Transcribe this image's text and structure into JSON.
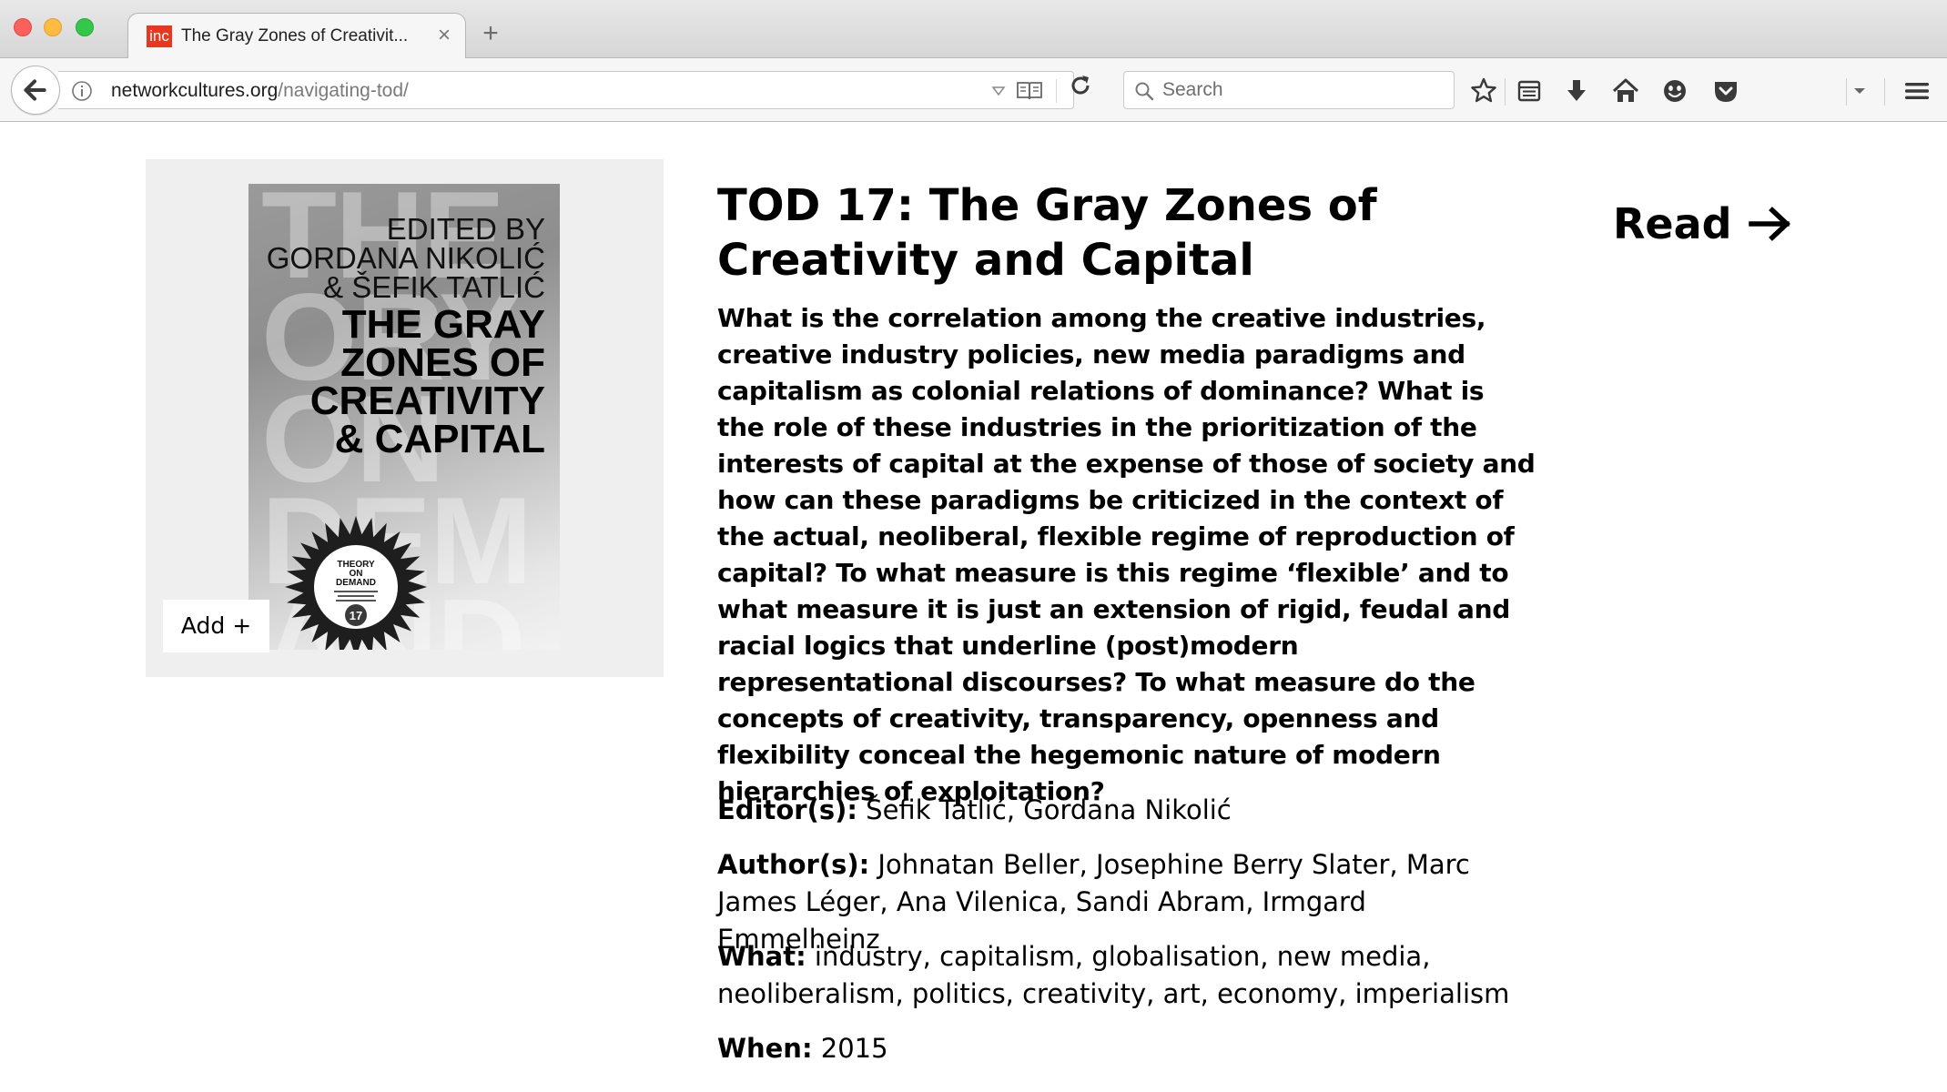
{
  "browser": {
    "tab": {
      "favicon_text": "inc",
      "title": "The Gray Zones of Creativit...",
      "close": "×"
    },
    "new_tab": "+",
    "url": {
      "domain": "networkcultures.org",
      "path": "/navigating-tod/"
    },
    "search": {
      "placeholder": "Search"
    },
    "icons": [
      "back-arrow-icon",
      "info-icon",
      "dropdown-icon",
      "reader-view-icon",
      "reload-icon",
      "search-icon",
      "bookmark-star-icon",
      "bookmarks-library-icon",
      "download-icon",
      "home-icon",
      "emoji-icon",
      "pocket-icon",
      "overflow-dropdown-icon",
      "hamburger-menu-icon"
    ]
  },
  "cover": {
    "bg_letters": [
      "THE",
      "ORY",
      "ON",
      "DEM",
      "AND"
    ],
    "editors_lines": [
      "EDITED BY",
      "GORDANA NIKOLIĆ",
      "& ŠEFIK TATLIĆ"
    ],
    "title_lines": [
      "THE GRAY",
      "ZONES OF",
      "CREATIVITY",
      "& CAPITAL"
    ],
    "badge": {
      "line1": "THEORY",
      "line2": "ON",
      "line3": "DEMAND",
      "issue": "17"
    },
    "add_label": "Add +"
  },
  "article": {
    "title": "TOD 17: The Gray Zones of Creativity and Capital",
    "description": "What is the correlation among the creative industries, creative industry policies, new media paradigms and capitalism as colonial relations of dominance? What is the role of these industries in the prioritization of the interests of capital at the expense of those of society and how can these paradigms be criticized in the context of the actual, neoliberal, flexible regime of reproduction of capital? To what measure is this regime ‘flexible’ and to what measure it is just an extension of rigid, feudal and racial logics that underline (post)modern representational discourses? To what measure do the concepts of creativity, transparency, openness and flexibility conceal the hegemonic nature of modern hierarchies of exploitation?",
    "editors_label": "Editor(s):",
    "editors_value": " Šefik Tatlić, Gordana Nikolić",
    "authors_label": "Author(s):",
    "authors_value": " Johnatan Beller, Josephine Berry Slater, Marc James Léger, Ana Vilenica, Sandi Abram, Irmgard Emmelheinz",
    "what_label": "What:",
    "what_value": " industry, capitalism, globalisation, new media, neoliberalism, politics, creativity, art, economy, imperialism",
    "when_label": "When:",
    "when_value": " 2015",
    "read_label": "Read"
  }
}
